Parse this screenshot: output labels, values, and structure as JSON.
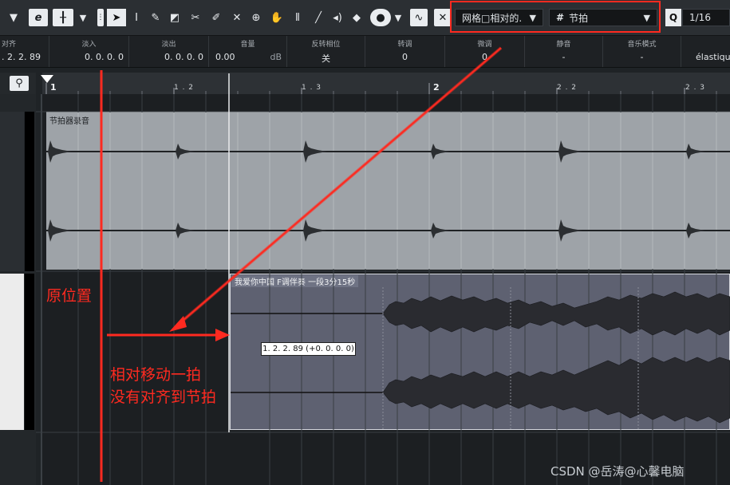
{
  "toolbar": {
    "snap_type": "网格□相对的.",
    "grid_type": "节拍",
    "quantize_label": "Q",
    "quantize_value": "1/16",
    "icons": [
      "dropdown-arrow",
      "e-icon",
      "mixer-icon",
      "dropdown-arrow",
      "handle-icon",
      "pointer-tool-icon",
      "range-tool-icon",
      "draw-tool-icon",
      "erase-tool-icon",
      "split-tool-icon",
      "glue-tool-icon",
      "mute-tool-icon",
      "zoom-tool-icon",
      "hand-tool-icon",
      "timewarp-tool-icon",
      "line-tool-icon",
      "play-tool-icon",
      "comp-tool-icon",
      "color-icon",
      "curve-icon",
      "snap-icon"
    ]
  },
  "infoline": [
    {
      "label": "对齐",
      "value": ". 2. 2. 89"
    },
    {
      "label": "淡入",
      "value": "0. 0. 0.   0"
    },
    {
      "label": "淡出",
      "value": "0. 0. 0.   0"
    },
    {
      "label": "音量",
      "value": "0.00",
      "unit": "dB"
    },
    {
      "label": "反转相位",
      "value": "关"
    },
    {
      "label": "转调",
      "value": "0"
    },
    {
      "label": "微调",
      "value": "0"
    },
    {
      "label": "静音",
      "value": "-"
    },
    {
      "label": "音乐模式",
      "value": "-"
    },
    {
      "label": "",
      "value": "élastique"
    }
  ],
  "ruler": {
    "bars": [
      {
        "label": "1",
        "major": true
      },
      {
        "label": "1 . 2",
        "major": false
      },
      {
        "label": "1 . 3",
        "major": false
      },
      {
        "label": "2",
        "major": true
      },
      {
        "label": "2 . 2",
        "major": false
      },
      {
        "label": "2 . 3",
        "major": false
      }
    ]
  },
  "events": {
    "metronome_title": "节拍器录音",
    "audio_title": "我爱你中国 F调伴奏 一段3分15秒",
    "position_tooltip": "1. 2. 2. 89 (+0. 0. 0. 0)"
  },
  "annotations": {
    "original_position": "原位置",
    "line1": "相对移动一拍",
    "line2": "没有对齐到节拍",
    "color": "#ff2a20"
  },
  "watermark": "CSDN @岳涛@心馨电脑"
}
